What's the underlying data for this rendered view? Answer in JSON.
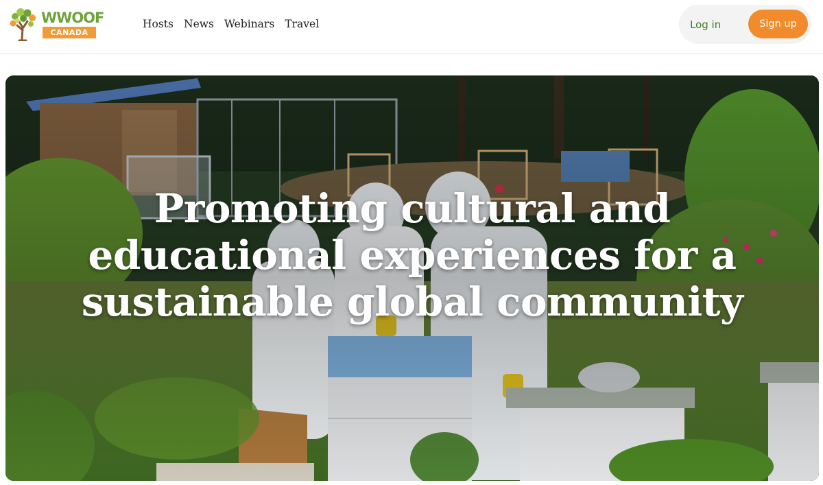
{
  "logo": {
    "wordmark": "WWOOF",
    "badge": "CANADA"
  },
  "nav": {
    "items": [
      {
        "label": "Hosts"
      },
      {
        "label": "News"
      },
      {
        "label": "Webinars"
      },
      {
        "label": "Travel"
      }
    ]
  },
  "auth": {
    "login_label": "Log in",
    "signup_label": "Sign up"
  },
  "hero": {
    "title_line1": "Promoting cultural and",
    "title_line2": "educational experiences for a",
    "title_line3": "sustainable global community"
  },
  "colors": {
    "brand_green": "#6fa33a",
    "brand_orange": "#f18b2b",
    "login_green": "#3f7a27"
  }
}
